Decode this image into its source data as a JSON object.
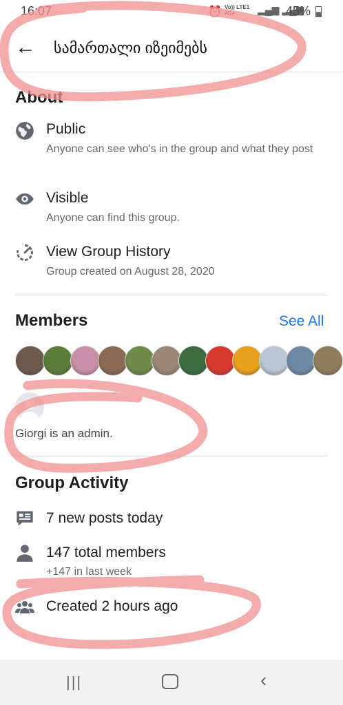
{
  "status_bar": {
    "time": "16:07",
    "network": "Vo)) LTE1 4G+",
    "battery": "45%"
  },
  "header": {
    "title": "სამართალი იზეიმებს"
  },
  "about": {
    "heading": "About",
    "items": [
      {
        "title": "Public",
        "subtitle": "Anyone can see who's in the group and what they post",
        "icon": "globe-icon"
      },
      {
        "title": "Visible",
        "subtitle": "Anyone can find this group.",
        "icon": "eye-icon"
      },
      {
        "title": "View Group History",
        "subtitle": "Group created on August 28, 2020",
        "icon": "history-icon"
      }
    ]
  },
  "members": {
    "heading": "Members",
    "see_all": "See All",
    "avatar_colors": [
      "#6b5a4e",
      "#5a7d3a",
      "#c98fa8",
      "#8a6a55",
      "#6f8a4a",
      "#9a8676",
      "#3c6b3f",
      "#d63a2f",
      "#e8a11c",
      "#b9c6d6",
      "#6d88a3",
      "#8f7d5c"
    ],
    "admin_text": "Giorgi is an admin."
  },
  "group_activity": {
    "heading": "Group Activity",
    "items": [
      {
        "title": "7 new posts today",
        "subtitle": "",
        "icon": "posts-icon"
      },
      {
        "title": "147 total members",
        "subtitle": "+147 in last week",
        "icon": "person-icon"
      },
      {
        "title": "Created 2 hours ago",
        "subtitle": "",
        "icon": "group-icon"
      }
    ]
  },
  "colors": {
    "link": "#1877f2",
    "annotation": "#f08f8f"
  }
}
